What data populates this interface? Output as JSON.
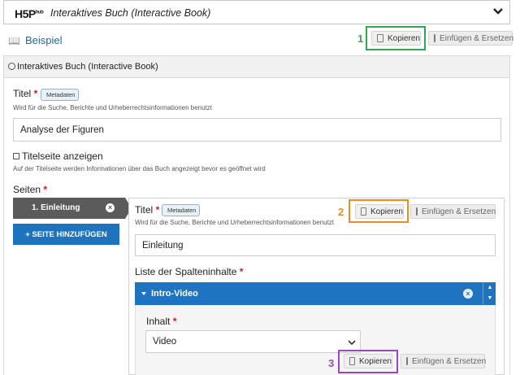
{
  "hub": {
    "logo": "H5P",
    "logo_sup": "hub",
    "title": "Interaktives Buch (Interactive Book)"
  },
  "example_link": "Beispiel",
  "copy_label": "Kopieren",
  "paste_label": "Einfügen & Ersetzen",
  "annotations": {
    "n1": "1",
    "n2": "2",
    "n3": "3",
    "color1": "#2fa84f",
    "color2": "#f08a24",
    "color3": "#9b48b8"
  },
  "section_title": "Interaktives Buch (Interactive Book)",
  "title_field": {
    "label": "Titel",
    "meta": "Metadaten",
    "desc": "Wird für die Suche, Berichte und Urheberrechtsinformationen benutzt",
    "value": "Analyse der Figuren"
  },
  "cover": {
    "label": "Titelseite anzeigen",
    "desc": "Auf der Titelseite werden Informationen über das Buch angezeigt bevor es geöffnet wird"
  },
  "pages_label": "Seiten",
  "chapter": {
    "label": "1. Einleitung"
  },
  "add_page": "+ SEITE HINZUFÜGEN",
  "chapter_title": {
    "label": "Titel",
    "meta": "Metadaten",
    "desc": "Wird für die Suche, Berichte und Urheberrechtsinformationen benutzt",
    "value": "Einleitung"
  },
  "column_label": "Liste der Spalteninhalte",
  "intro_video": {
    "label": "Intro-Video"
  },
  "content": {
    "label": "Inhalt",
    "value": "Video"
  }
}
